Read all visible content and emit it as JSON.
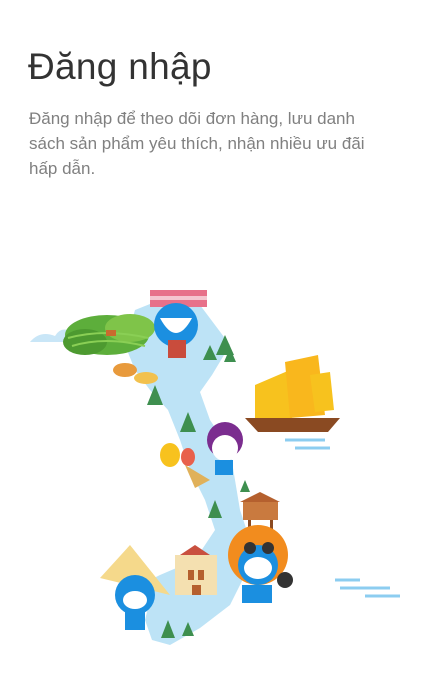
{
  "login": {
    "title": "Đăng nhập",
    "description": "Đăng nhập để theo dõi đơn hàng, lưu danh sách sản phẩm yêu thích, nhận nhiều ưu đãi hấp dẫn."
  },
  "colors": {
    "title_text": "#333333",
    "description_text": "#808080",
    "map_blue": "#BDE3F6",
    "character_blue": "#1B8FE0",
    "sail_yellow": "#F7C21E",
    "hill_green": "#5DAE3B"
  },
  "illustration": {
    "icon": "vietnam-map-illustration"
  }
}
